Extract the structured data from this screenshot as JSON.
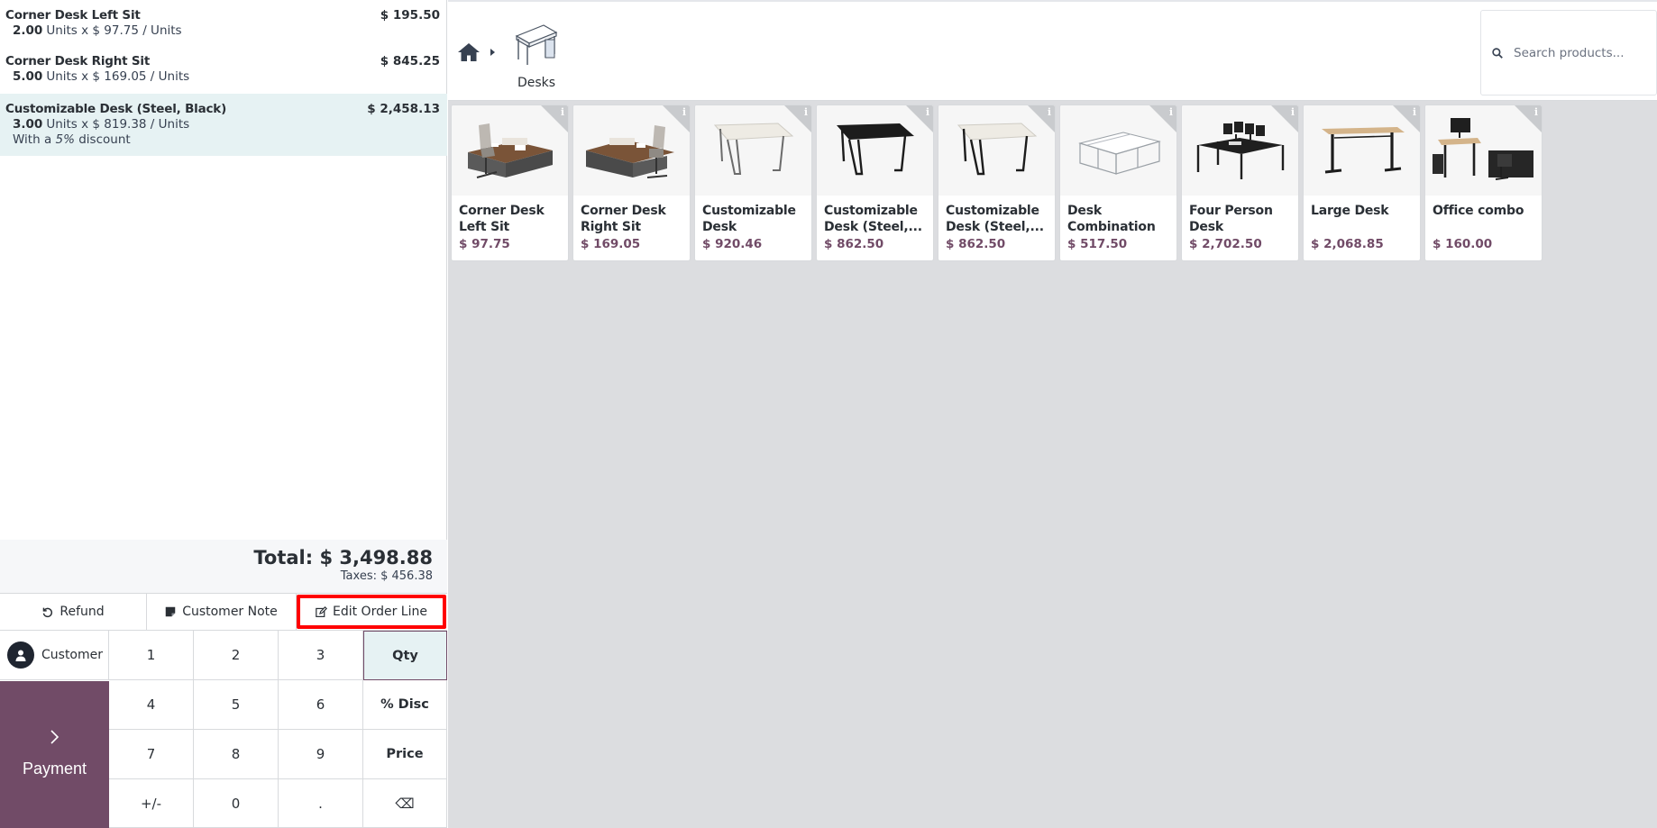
{
  "order": {
    "lines": [
      {
        "name": "Corner Desk Left Sit",
        "price": "$ 195.50",
        "qty": "2.00",
        "detail": "Units x $ 97.75 / Units"
      },
      {
        "name": "Corner Desk Right Sit",
        "price": "$ 845.25",
        "qty": "5.00",
        "detail": "Units x $ 169.05 / Units"
      },
      {
        "name": "Customizable Desk (Steel, Black)",
        "price": "$ 2,458.13",
        "qty": "3.00",
        "detail": "Units x $ 819.38 / Units",
        "discount_prefix": "With a",
        "discount_value": "5%",
        "discount_suffix": "discount"
      }
    ],
    "total": "Total: $ 3,498.88",
    "taxes": "Taxes: $ 456.38"
  },
  "controls": {
    "refund": "Refund",
    "customer_note": "Customer Note",
    "edit_order_line": "Edit Order Line"
  },
  "pad": {
    "customer": "Customer",
    "payment": "Payment",
    "keys": [
      "1",
      "2",
      "3",
      "Qty",
      "4",
      "5",
      "6",
      "% Disc",
      "7",
      "8",
      "9",
      "Price",
      "+/-",
      "0",
      ".",
      "⌫"
    ]
  },
  "breadcrumb": {
    "category": "Desks"
  },
  "search": {
    "placeholder": "Search products..."
  },
  "products": [
    {
      "name": "Corner Desk Left Sit",
      "price": "$ 97.75"
    },
    {
      "name": "Corner Desk Right Sit",
      "price": "$ 169.05"
    },
    {
      "name": "Customizable Desk (Aluminiu...",
      "price": "$ 920.46"
    },
    {
      "name": "Customizable Desk (Steel,...",
      "price": "$ 862.50"
    },
    {
      "name": "Customizable Desk (Steel,...",
      "price": "$ 862.50"
    },
    {
      "name": "Desk Combination",
      "price": "$ 517.50"
    },
    {
      "name": "Four Person Desk",
      "price": "$ 2,702.50"
    },
    {
      "name": "Large Desk",
      "price": "$ 2,068.85"
    },
    {
      "name": "Office combo",
      "price": "$ 160.00"
    }
  ],
  "colors": {
    "brand": "#714b67",
    "selected_line": "#e6f2f3",
    "highlight_box": "#ff0000"
  }
}
